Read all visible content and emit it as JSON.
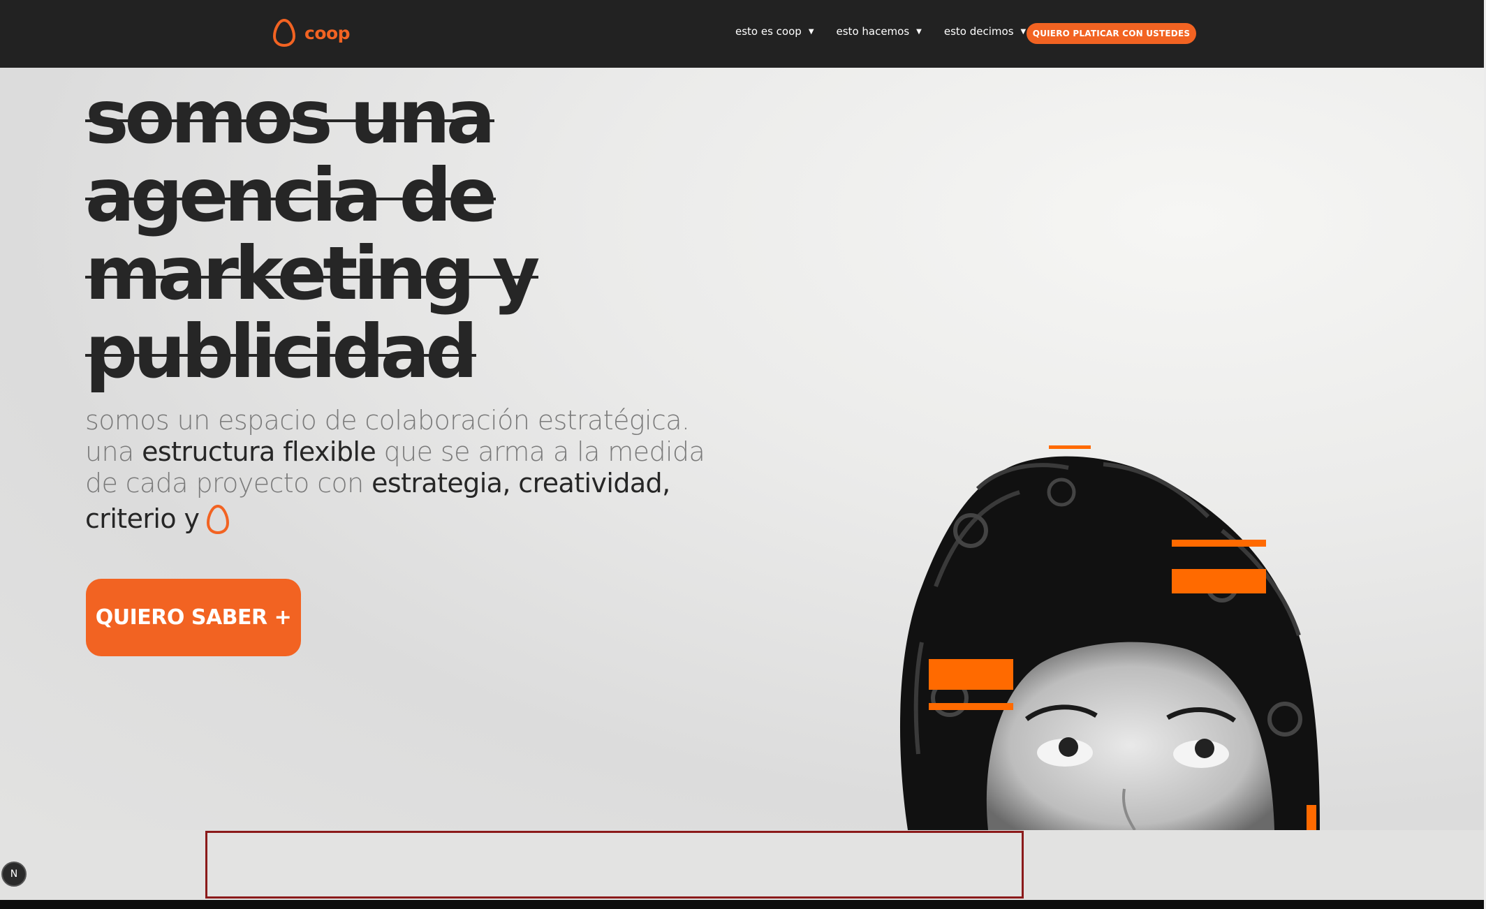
{
  "brand": {
    "name": "coop",
    "accent": "#f26322"
  },
  "nav": {
    "items": [
      {
        "label": "esto es coop",
        "caret": "▼"
      },
      {
        "label": "esto hacemos",
        "caret": "▼"
      },
      {
        "label": "esto decimos",
        "caret": "▼"
      }
    ],
    "cta": "QUIERO PLATICAR CON USTEDES"
  },
  "hero": {
    "heading_lines": [
      "somos una",
      "agencia de",
      "marketing y",
      "publicidad"
    ],
    "desc": {
      "p1": "somos un espacio de colaboración estratégica.",
      "p2a": "una ",
      "p2b": "estructura flexible",
      "p2c": " que se arma a la medida",
      "p3a": "de cada proyecto con ",
      "p3b": "estrategia, creatividad,",
      "p4": "criterio y"
    },
    "cta": "QUIERO SABER +"
  },
  "badge": "N"
}
